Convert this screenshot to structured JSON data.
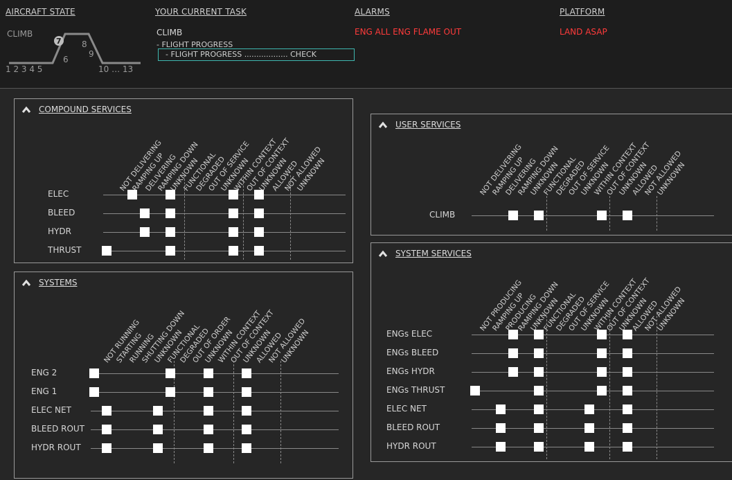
{
  "header": {
    "aircraft_state": {
      "title": "AIRCRAFT STATE",
      "phase": "CLIMB",
      "numbers": [
        "1 2 3 4 5",
        "6",
        "7",
        "8",
        "9",
        "10 … 13"
      ]
    },
    "current_task": {
      "title": "YOUR CURRENT TASK",
      "task": "CLIMB",
      "sub": "- FLIGHT PROGRESS",
      "check": "- FLIGHT PROGRESS .................. CHECK"
    },
    "alarms": {
      "title": "ALARMS",
      "text": "ENG ALL ENG FLAME OUT"
    },
    "platform": {
      "title": "PLATFORM",
      "text": "LAND ASAP"
    }
  },
  "colors": {
    "alarm": "#ff3b3b",
    "highlight": "#3fb8b0",
    "marker": "#ffffff"
  },
  "panels": {
    "compound": {
      "title": "COMPOUND SERVICES",
      "headers": [
        "NOT DELIVERING",
        "RAMPING UP",
        "DELIVERING",
        "RAMPING DOWN",
        "UNKNOWN",
        "FUNCTIONAL",
        "DEGRADED",
        "OUT OF SERVICE",
        "UNKNOWN",
        "WITHIN CONTEXT",
        "OUT OF CONTEXT",
        "UNKNOWN",
        "ALLOWED",
        "NOT ALLOWED",
        "UNKNOWN"
      ],
      "rows": [
        {
          "label": "ELEC",
          "marks": [
            2,
            5,
            10,
            12
          ]
        },
        {
          "label": "BLEED",
          "marks": [
            3,
            5,
            10,
            12
          ]
        },
        {
          "label": "HYDR",
          "marks": [
            3,
            5,
            10,
            12
          ]
        },
        {
          "label": "THRUST",
          "marks": [
            0,
            5,
            10,
            12
          ]
        }
      ]
    },
    "user": {
      "title": "USER SERVICES",
      "headers": [
        "NOT DELIVERING",
        "RAMPING UP",
        "DELIVERING",
        "RAMPING DOWN",
        "UNKNOWN",
        "FUNCTIONAL",
        "DEGRADED",
        "OUT OF SERVICE",
        "UNKNOWN",
        "WITHIN CONTEXT",
        "OUT OF CONTEXT",
        "UNKNOWN",
        "ALLOWED",
        "NOT ALLOWED",
        "UNKNOWN"
      ],
      "rows": [
        {
          "label": "CLIMB",
          "marks": [
            3,
            5,
            10,
            12
          ]
        }
      ]
    },
    "systems": {
      "title": "SYSTEMS",
      "headers": [
        "NOT RUNNING",
        "STARTING",
        "RUNNING",
        "SHUTTING DOWN",
        "UNKNOWN",
        "FUNCTIONAL",
        "DEGRADED",
        "OUT OF ORDER",
        "UNKNOWN",
        "WITHIN CONTEXT",
        "OUT OF CONTEXT",
        "UNKNOWN",
        "ALLOWED",
        "NOT ALLOWED",
        "UNKNOWN"
      ],
      "rows": [
        {
          "label": "ENG 2",
          "marks": [
            0,
            6,
            9,
            12
          ]
        },
        {
          "label": "ENG 1",
          "marks": [
            0,
            6,
            9,
            12
          ]
        },
        {
          "label": "ELEC NET",
          "marks": [
            1,
            5,
            9,
            12
          ]
        },
        {
          "label": "BLEED ROUT",
          "marks": [
            1,
            5,
            9,
            12
          ]
        },
        {
          "label": "HYDR ROUT",
          "marks": [
            1,
            5,
            9,
            12
          ]
        }
      ]
    },
    "system_services": {
      "title": "SYSTEM SERVICES",
      "headers": [
        "NOT PRODUCING",
        "RAMPING UP",
        "PRODUCING",
        "RAMPING DOWN",
        "UNKNOWN",
        "FUNCTIONAL",
        "DEGRADED",
        "OUT OF SERVICE",
        "UNKNOWN",
        "WITHIN CONTEXT",
        "OUT OF CONTEXT",
        "UNKNOWN",
        "ALLOWED",
        "NOT ALLOWED",
        "UNKNOWN"
      ],
      "rows": [
        {
          "label": "ENGs ELEC",
          "marks": [
            3,
            5,
            10,
            12
          ]
        },
        {
          "label": "ENGs BLEED",
          "marks": [
            3,
            5,
            10,
            12
          ]
        },
        {
          "label": "ENGs HYDR",
          "marks": [
            3,
            5,
            10,
            12
          ]
        },
        {
          "label": "ENGs THRUST",
          "marks": [
            0,
            5,
            10,
            12
          ]
        },
        {
          "label": "ELEC NET",
          "marks": [
            2,
            5,
            9,
            12
          ]
        },
        {
          "label": "BLEED ROUT",
          "marks": [
            2,
            5,
            9,
            12
          ]
        },
        {
          "label": "HYDR ROUT",
          "marks": [
            2,
            5,
            9,
            12
          ]
        }
      ]
    }
  }
}
